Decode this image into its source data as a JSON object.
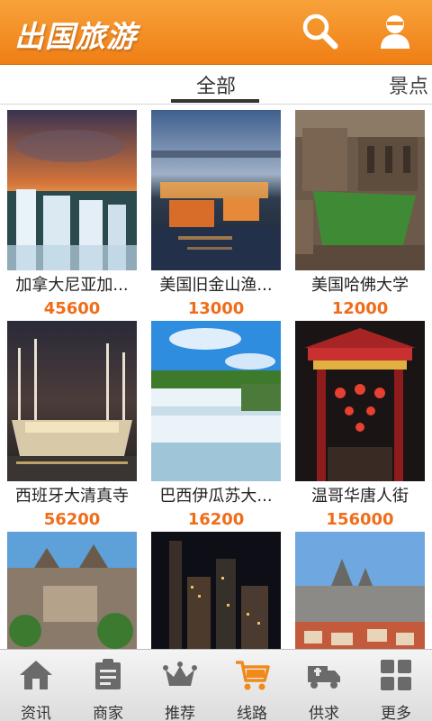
{
  "header": {
    "title": "出国旅游",
    "search_icon": "search-icon",
    "user_icon": "user-icon",
    "color": "#f39125"
  },
  "tabs": [
    {
      "label": "全部",
      "active": true
    },
    {
      "label": "景点",
      "active": false
    }
  ],
  "grid": {
    "items": [
      {
        "title": "加拿大尼亚加...",
        "count": "45600"
      },
      {
        "title": "美国旧金山渔...",
        "count": "13000"
      },
      {
        "title": "美国哈佛大学",
        "count": "12000"
      },
      {
        "title": "西班牙大清真寺",
        "count": "56200"
      },
      {
        "title": "巴西伊瓜苏大...",
        "count": "16200"
      },
      {
        "title": "温哥华唐人街",
        "count": "156000"
      },
      {
        "title": "",
        "count": ""
      },
      {
        "title": "",
        "count": ""
      },
      {
        "title": "",
        "count": ""
      }
    ],
    "price_color": "#ef6d1a"
  },
  "bottom_nav": [
    {
      "label": "资讯",
      "icon": "home-icon"
    },
    {
      "label": "商家",
      "icon": "shop-doc-icon"
    },
    {
      "label": "推荐",
      "icon": "crown-icon"
    },
    {
      "label": "线路",
      "icon": "cart-icon",
      "active": true
    },
    {
      "label": "供求",
      "icon": "truck-icon"
    },
    {
      "label": "更多",
      "icon": "grid-icon"
    }
  ],
  "accent_color": "#f39125"
}
